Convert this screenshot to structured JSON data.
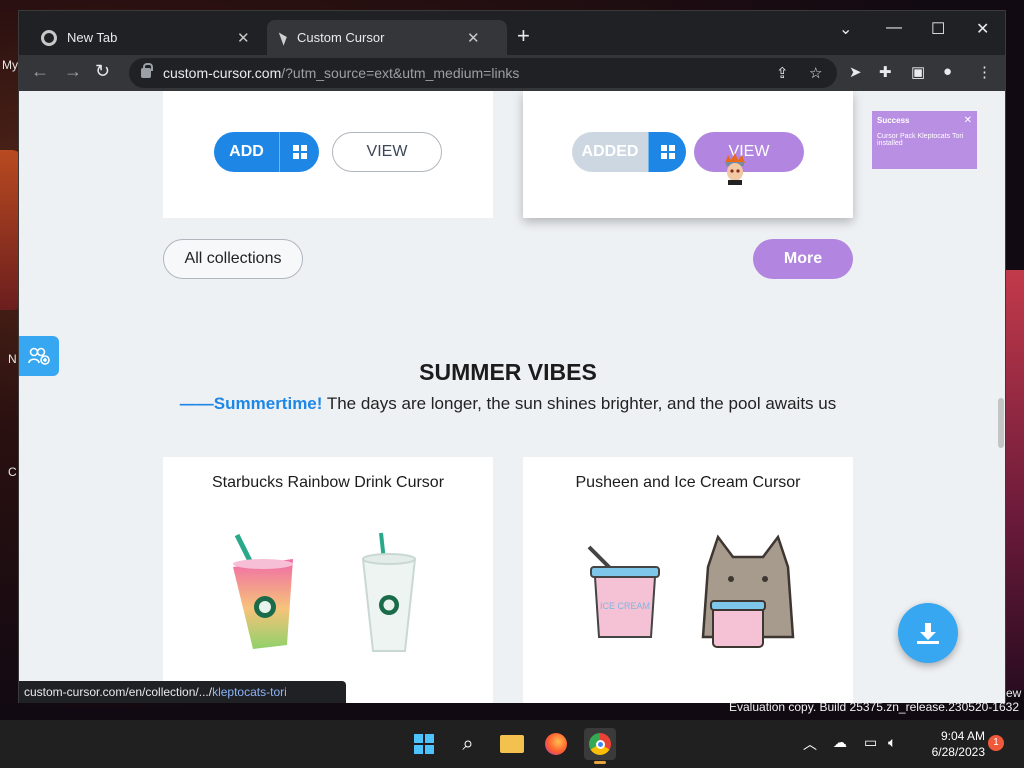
{
  "desktop": {
    "labels": [
      "My",
      "N",
      "C"
    ],
    "eval_text": "Evaluation copy. Build 25375.zn_release.230520-1632",
    "right_label": "ew"
  },
  "browser": {
    "tabs": [
      {
        "title": "New Tab",
        "active": false,
        "icon": "chrome-icon"
      },
      {
        "title": "Custom Cursor",
        "active": true,
        "icon": "cursor-favicon"
      }
    ],
    "url_main": "custom-cursor.com",
    "url_rest": "/?utm_source=ext&utm_medium=links",
    "status_url_prefix": "custom-cursor.com/en/collection/.../",
    "status_url_suffix": "kleptocats-tori"
  },
  "page": {
    "top_left_card": {
      "add_label": "ADD",
      "view_label": "VIEW"
    },
    "top_right_card": {
      "added_label": "ADDED",
      "view_label": "VIEW"
    },
    "all_collections_label": "All collections",
    "more_label": "More",
    "toast": {
      "title": "Success",
      "message": "Cursor Pack Kleptocats Tori installed"
    },
    "section": {
      "title": "SUMMER VIBES",
      "accent": "——Summertime!",
      "subtitle": " The days are longer, the sun shines brighter, and the pool awaits us"
    },
    "cards": [
      {
        "title": "Starbucks Rainbow Drink Cursor"
      },
      {
        "title": "Pusheen and Ice Cream Cursor"
      }
    ],
    "ice_cream_label": "ICE CREAM"
  },
  "colors": {
    "accent_blue": "#1e87e6",
    "accent_purple": "#b285e0",
    "fab_blue": "#36a7f0"
  },
  "taskbar": {
    "time": "9:04 AM",
    "date": "6/28/2023",
    "notifications": "1",
    "apps": [
      "windows-start-icon",
      "search-icon",
      "file-explorer-icon",
      "firefox-icon",
      "chrome-icon"
    ]
  }
}
